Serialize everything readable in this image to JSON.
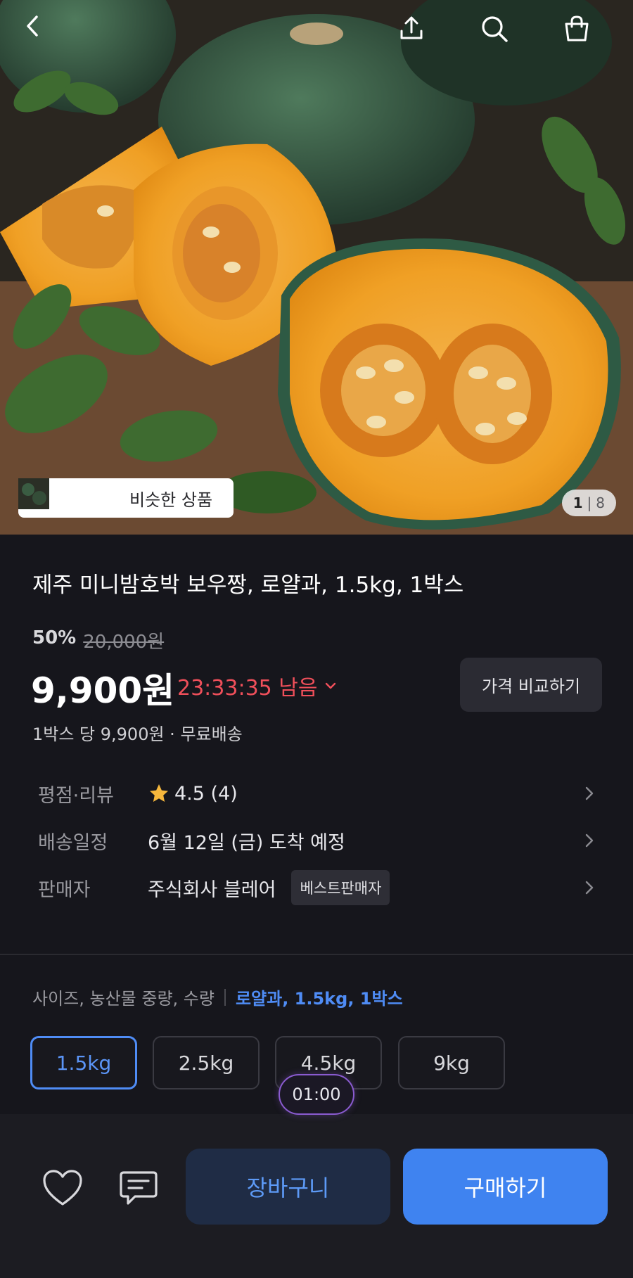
{
  "hero": {
    "similar_label": "비슷한 상품",
    "counter_current": "1",
    "counter_total": "8"
  },
  "product": {
    "title": "제주 미니밤호박 보우짱, 로얄과, 1.5kg, 1박스",
    "discount": "50%",
    "original_price": "20,000원",
    "price": "9,900원",
    "timer": "23:33:35 남음",
    "compare_button": "가격 비교하기",
    "unit_price": "1박스 당 9,900원 · 무료배송"
  },
  "details": [
    {
      "label": "평점·리뷰",
      "value": "4.5 (4)"
    },
    {
      "label": "배송일정",
      "value": "6월 12일 (금) 도착 예정"
    },
    {
      "label": "판매자",
      "value": "주식회사 블레어",
      "badge": "베스트판매자"
    }
  ],
  "options": {
    "header_label": "사이즈, 농산물 중량, 수량",
    "selected_value": "로얄과, 1.5kg, 1박스",
    "chips": [
      "1.5kg",
      "2.5kg",
      "4.5kg",
      "9kg"
    ],
    "active_index": 0
  },
  "float_timer": "01:00",
  "bottom": {
    "cart_label": "장바구니",
    "buy_label": "구매하기"
  },
  "colors": {
    "accent": "#3f83f0",
    "timer_red": "#ef4f5a",
    "background": "#16161c"
  },
  "icons": [
    "back-icon",
    "share-icon",
    "search-icon",
    "bag-icon",
    "star-icon",
    "chevron-right-icon",
    "heart-icon",
    "chat-icon"
  ]
}
